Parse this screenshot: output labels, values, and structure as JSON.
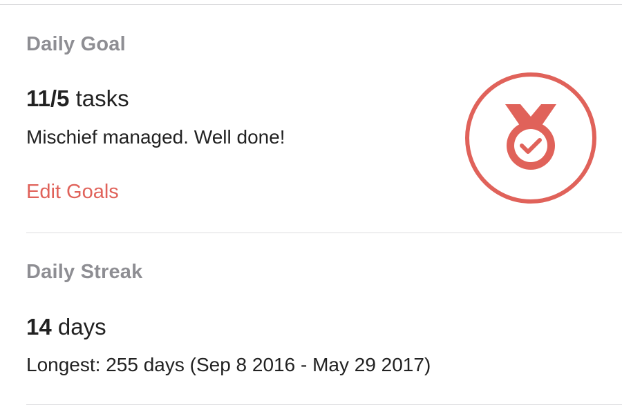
{
  "goal": {
    "label": "Daily Goal",
    "value": "11/5",
    "unit": "tasks",
    "message": "Mischief managed. Well done!",
    "edit_label": "Edit Goals",
    "badge_icon": "medal-check-icon"
  },
  "streak": {
    "label": "Daily Streak",
    "value": "14",
    "unit": "days",
    "longest": "Longest: 255 days (Sep 8 2016 - May 29 2017)"
  },
  "colors": {
    "accent": "#e0625a",
    "label_gray": "#8e8e93",
    "divider": "#dcdcde"
  }
}
